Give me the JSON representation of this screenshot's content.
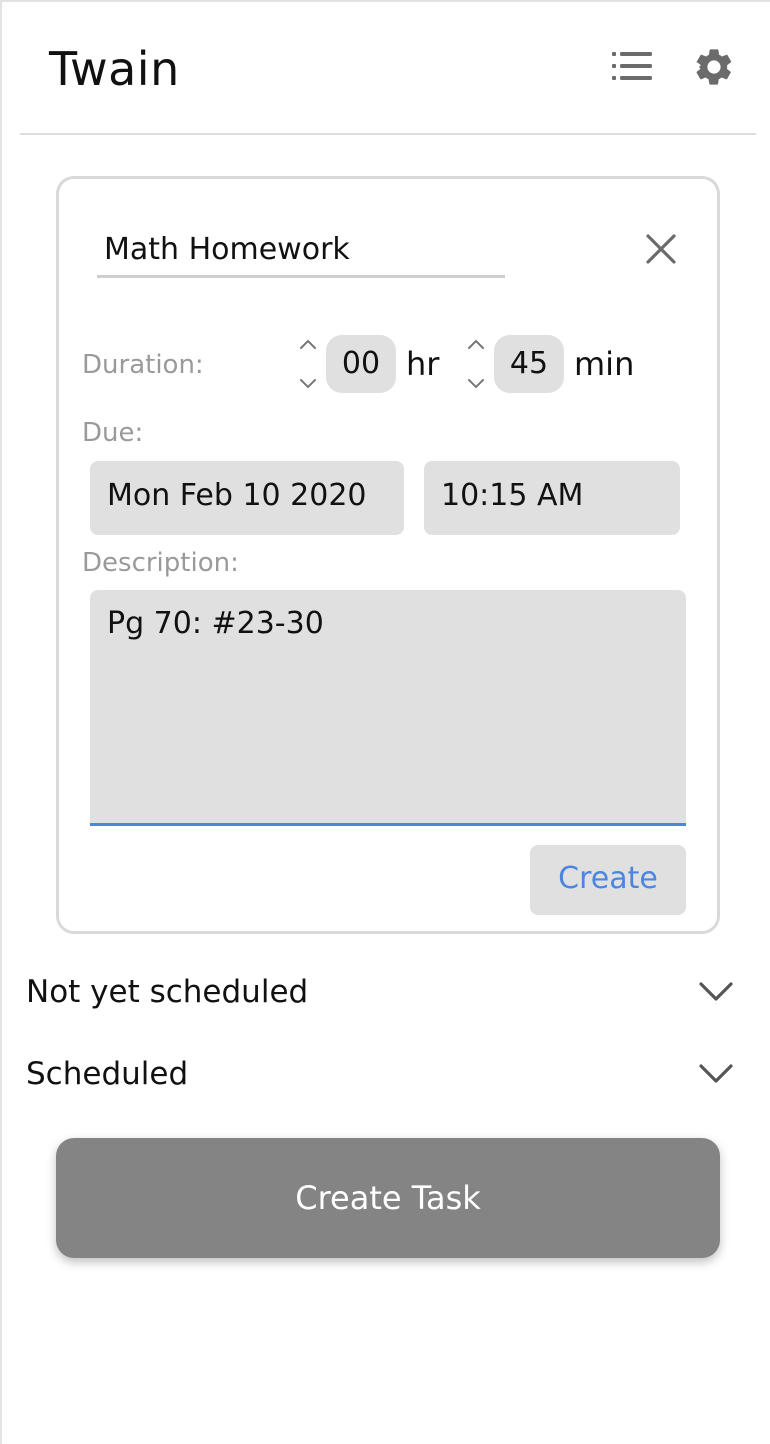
{
  "app": {
    "title": "Twain"
  },
  "task_form": {
    "title_value": "Math Homework",
    "duration_label": "Duration:",
    "duration_hours": "00",
    "hours_unit": "hr",
    "duration_minutes": "45",
    "minutes_unit": "min",
    "due_label": "Due:",
    "due_date": "Mon Feb 10 2020",
    "due_time": "10:15 AM",
    "description_label": "Description:",
    "description_value": "Pg 70: #23-30",
    "create_label": "Create"
  },
  "sections": [
    {
      "label": "Not yet scheduled",
      "icon": "chevron-down-icon"
    },
    {
      "label": "Scheduled",
      "icon": "chevron-down-icon"
    }
  ],
  "create_task_label": "Create Task",
  "colors": {
    "accent": "#4a86e0",
    "field_bg": "#e0e0e0",
    "primary_button": "#848484",
    "icon": "#6b6b6b"
  }
}
